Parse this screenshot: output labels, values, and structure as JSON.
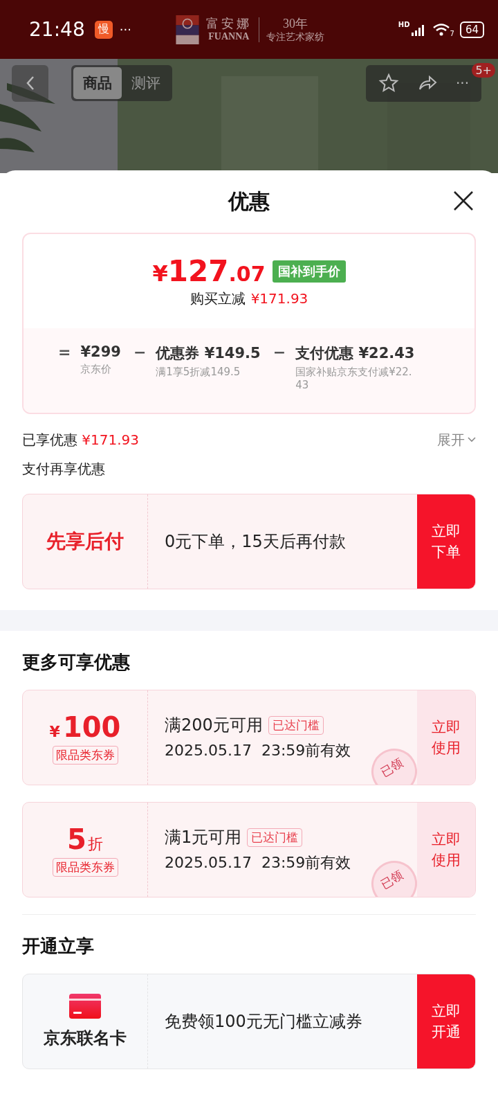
{
  "status_bar": {
    "time": "21:48",
    "app_icon_text": "慢",
    "more": "···",
    "brand": {
      "name_cn": "富安娜",
      "name_en": "FUANNA",
      "years": "30年",
      "slogan": "专注艺术家纺"
    },
    "network": "HD",
    "wifi_label": "7",
    "battery": "64"
  },
  "nav": {
    "tabs": [
      {
        "label": "商品",
        "selected": true
      },
      {
        "label": "测评",
        "selected": false
      }
    ],
    "more": "···",
    "badge": "5+"
  },
  "sheet": {
    "title": "优惠",
    "price": {
      "currency": "¥",
      "integer": "127",
      "decimal": ".07",
      "tag": "国补到手价",
      "saving_label": "购买立减",
      "saving": "¥171.93",
      "breakdown": [
        {
          "op": "=",
          "amount": "¥299",
          "note": "京东价"
        },
        {
          "op": "−",
          "amount": "优惠券 ¥149.5",
          "note": "满1享5折减149.5"
        },
        {
          "op": "−",
          "amount": "支付优惠 ¥22.43",
          "note": "国家补贴京东支付减¥22.43"
        }
      ]
    },
    "enjoyed": {
      "label": "已享优惠",
      "amount": "¥171.93",
      "expand": "展开"
    },
    "pay_section": {
      "title": "支付再享优惠",
      "name": "先享后付",
      "desc": "0元下单，15天后再付款",
      "action": "立即下单"
    },
    "more_section": {
      "title": "更多可享优惠",
      "coupons": [
        {
          "kind": "amount",
          "prefix": "¥",
          "value": "100",
          "type": "限品类东券",
          "condition": "满200元可用",
          "tag": "已达门槛",
          "validity": "2025.05.17  23:59前有效",
          "stamp": "已领",
          "action": "立即使用"
        },
        {
          "kind": "discount",
          "value": "5",
          "unit": "折",
          "type": "限品类东券",
          "condition": "满1元可用",
          "tag": "已达门槛",
          "validity": "2025.05.17  23:59前有效",
          "stamp": "已领",
          "action": "立即使用"
        }
      ]
    },
    "open_section": {
      "title": "开通立享",
      "name": "京东联名卡",
      "desc": "免费领100元无门槛立减券",
      "action": "立即开通"
    }
  }
}
